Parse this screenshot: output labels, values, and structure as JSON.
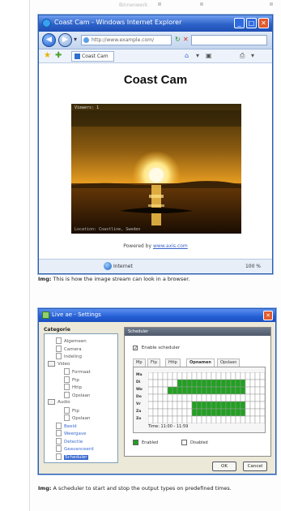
{
  "page_header": {
    "dim_text": "Binnenwerk"
  },
  "figure1": {
    "window_title": "Coast Cam - Windows Internet Explorer",
    "address": "http://www.example.com/",
    "tab_label": "Coast Cam",
    "page_heading": "Coast Cam",
    "camera": {
      "viewers": "Viewers: 1",
      "overlay_text": "Location: Coastline, Sweden"
    },
    "powered_by": "Powered by",
    "powered_link": "www.axis.com",
    "status_zone": "Internet",
    "zoom": "100 %",
    "caption_bold": "Img:",
    "caption_text": "This is how the image stream can look in a browser."
  },
  "figure2": {
    "dialog_title": "Live ae - Settings",
    "category_label": "Categorie",
    "tree": [
      {
        "label": "Algemeen",
        "type": "file",
        "indent": 1
      },
      {
        "label": "Camera",
        "type": "file",
        "indent": 1
      },
      {
        "label": "Indeling",
        "type": "file",
        "indent": 1
      },
      {
        "label": "Video",
        "type": "folder",
        "indent": 0
      },
      {
        "label": "Formaat",
        "type": "file",
        "indent": 2
      },
      {
        "label": "Ftp",
        "type": "file",
        "indent": 2
      },
      {
        "label": "Http",
        "type": "file",
        "indent": 2
      },
      {
        "label": "Opslaan",
        "type": "file",
        "indent": 2
      },
      {
        "label": "Audio",
        "type": "folder",
        "indent": 0
      },
      {
        "label": "Ftp",
        "type": "file",
        "indent": 2
      },
      {
        "label": "Opslaan",
        "type": "file",
        "indent": 2
      },
      {
        "label": "Beeld",
        "type": "file",
        "indent": 1,
        "highlight": true
      },
      {
        "label": "Weergave",
        "type": "file",
        "indent": 1,
        "highlight": true
      },
      {
        "label": "Detectie",
        "type": "file",
        "indent": 1,
        "highlight": true
      },
      {
        "label": "Geavanceerd",
        "type": "file",
        "indent": 1,
        "highlight": true
      },
      {
        "label": "Scheduler",
        "type": "file",
        "indent": 1,
        "selected": true
      }
    ],
    "panel_title": "Scheduler",
    "enable_label": "Enable scheduler",
    "enable_checked": true,
    "tabs": [
      "Mp",
      "Ftp",
      "Http",
      "Opnamen",
      "Opslaan"
    ],
    "active_tab": 3,
    "days": [
      "Ma",
      "Di",
      "Wo",
      "Do",
      "Vr",
      "Za",
      "Zo"
    ],
    "time_label": "Time: 11:00 - 11:59",
    "legend": [
      {
        "label": "Enabled",
        "color": "#22a022"
      },
      {
        "label": "Disabled",
        "color": "#ffffff"
      }
    ],
    "schedule_rows": [
      [],
      [
        6,
        20
      ],
      [
        4,
        20
      ],
      [],
      [
        9,
        20
      ],
      [
        9,
        20
      ],
      []
    ],
    "schedule_cols": 24,
    "buttons": [
      "OK",
      "Cancel"
    ],
    "caption_bold": "Img:",
    "caption_text": "A scheduler to start and stop the output types on predefined times."
  }
}
